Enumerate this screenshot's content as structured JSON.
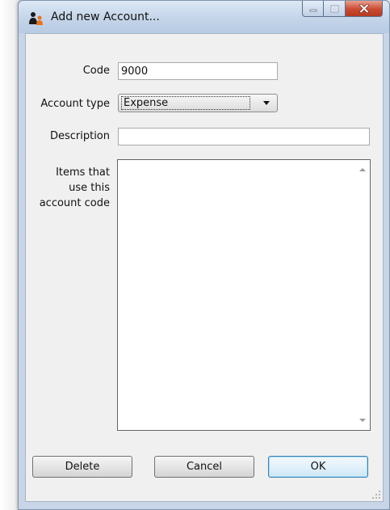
{
  "window": {
    "title": "Add new Account...",
    "app_icon": "people-icon",
    "controls": {
      "minimize": "minimize-icon",
      "maximize": "maximize-icon",
      "close": "close-icon"
    }
  },
  "form": {
    "code_label": "Code",
    "code_value": "9000",
    "account_type_label": "Account type",
    "account_type_value": "Expense",
    "description_label": "Description",
    "description_value": "",
    "items_label_line1": "Items that",
    "items_label_line2": "use this",
    "items_label_line3": "account code"
  },
  "buttons": {
    "delete": "Delete",
    "cancel": "Cancel",
    "ok": "OK"
  },
  "colors": {
    "close_button": "#c94a31",
    "default_button_border": "#3c7fb1"
  }
}
